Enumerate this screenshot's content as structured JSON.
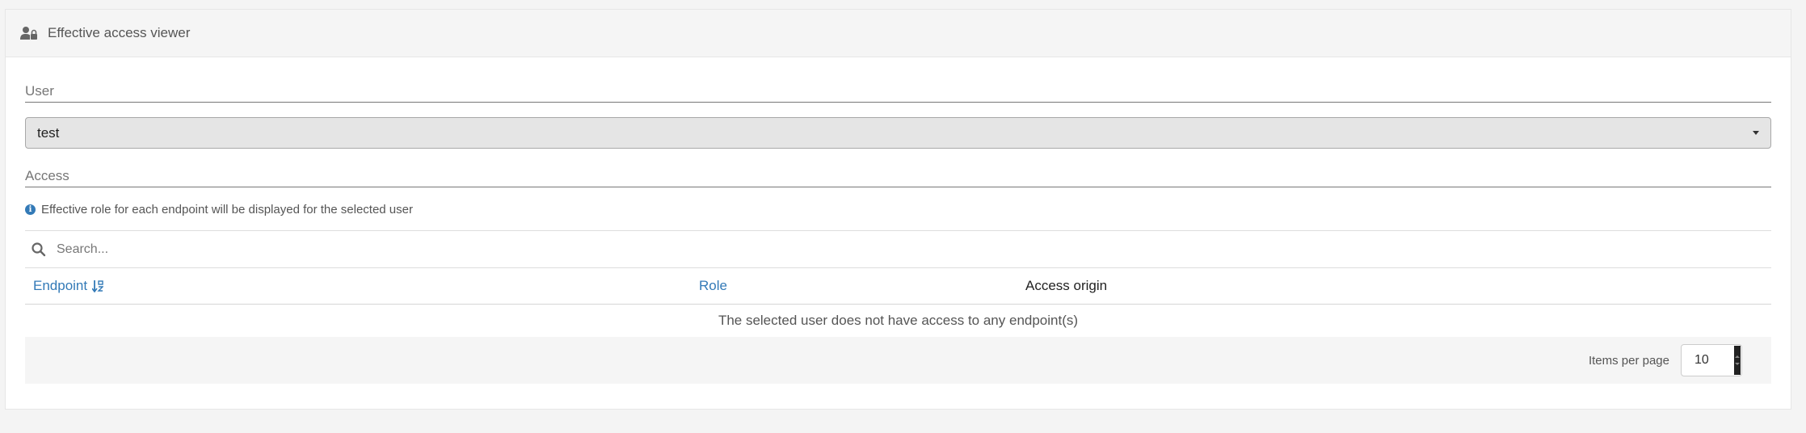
{
  "widget": {
    "title": "Effective access viewer",
    "icon": "user-lock-icon"
  },
  "user_section": {
    "title": "User",
    "selected_user": "test"
  },
  "access_section": {
    "title": "Access",
    "info_text": "Effective role for each endpoint will be displayed for the selected user",
    "search_placeholder": "Search..."
  },
  "table": {
    "columns": [
      {
        "label": "Endpoint",
        "sortable": true
      },
      {
        "label": "Role",
        "sortable": true
      },
      {
        "label": "Access origin",
        "sortable": false
      }
    ],
    "empty_message": "The selected user does not have access to any endpoint(s)"
  },
  "pagination": {
    "items_per_page_label": "Items per page",
    "items_per_page_value": "10"
  },
  "colors": {
    "link": "#337ab7",
    "header_bg": "#f5f5f5",
    "select_bg": "#e5e5e5"
  }
}
